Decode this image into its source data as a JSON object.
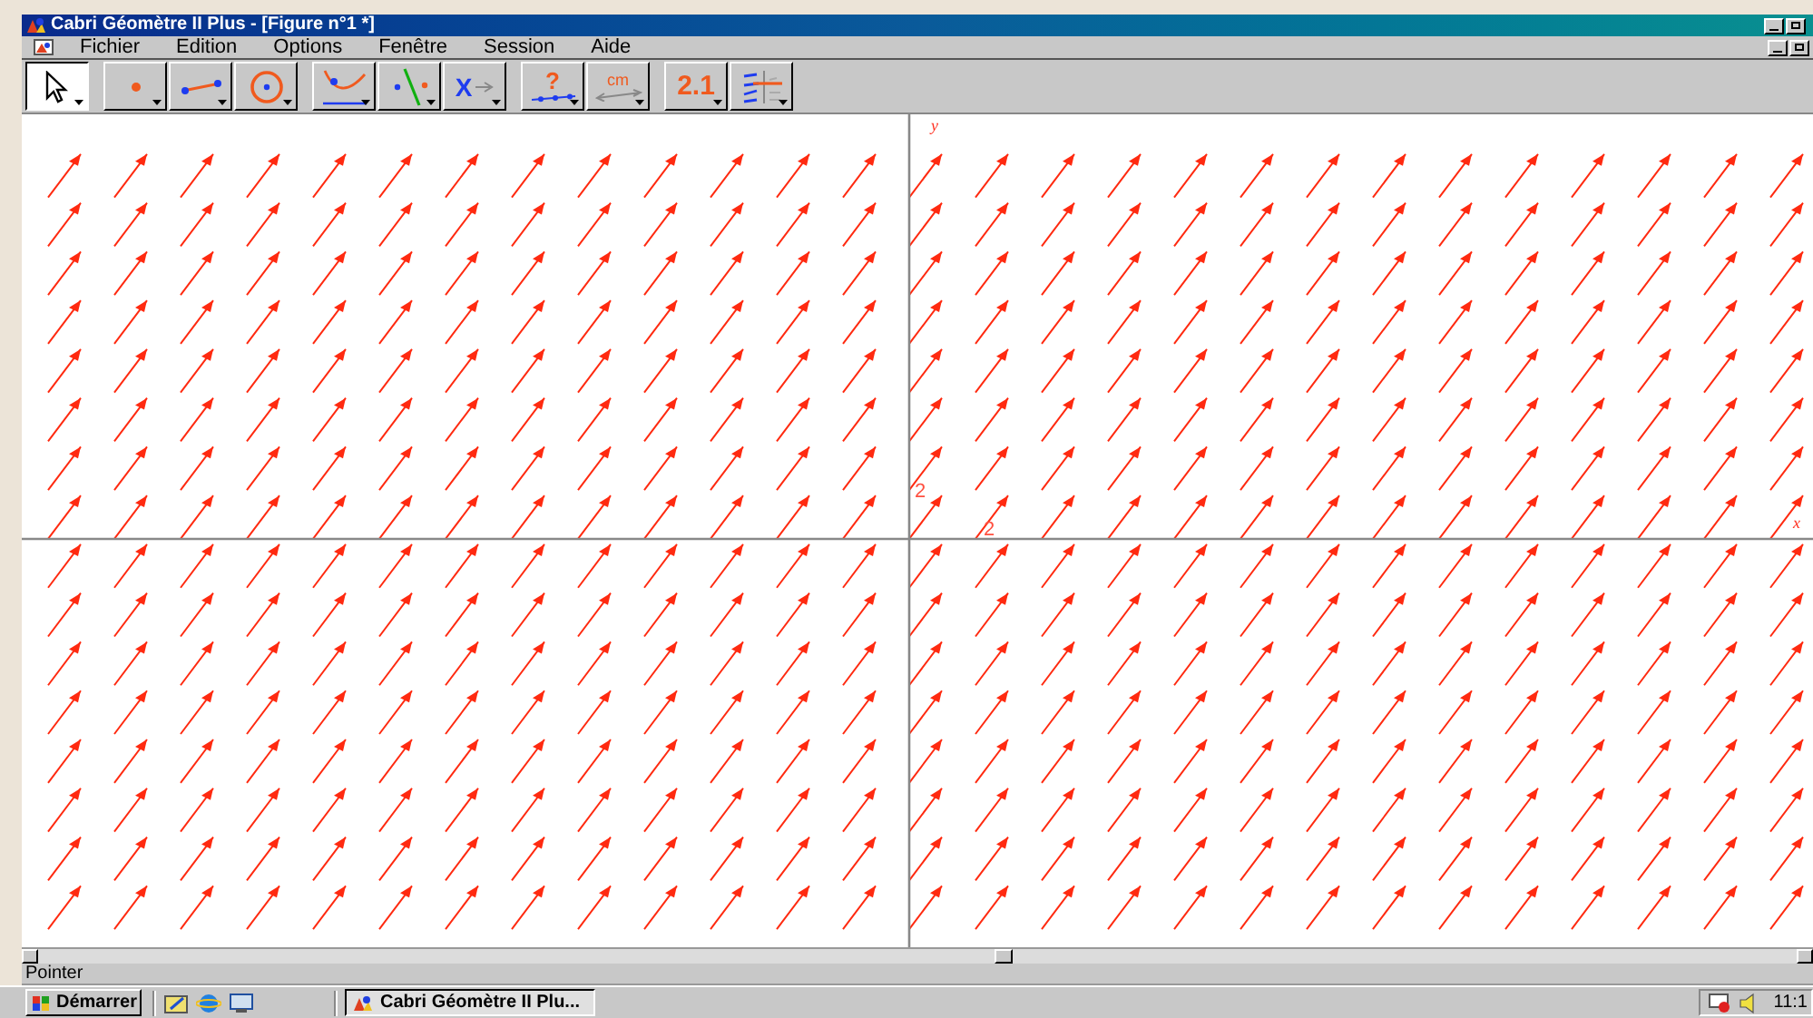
{
  "window": {
    "title": "Cabri Géomètre II Plus - [Figure n°1 *]"
  },
  "menu": [
    {
      "label": "Fichier"
    },
    {
      "label": "Edition"
    },
    {
      "label": "Options"
    },
    {
      "label": "Fenêtre"
    },
    {
      "label": "Session"
    },
    {
      "label": "Aide"
    }
  ],
  "toolbar": [
    {
      "kind": "pointer",
      "selected": true
    },
    {
      "kind": "point",
      "selected": false
    },
    {
      "kind": "line",
      "selected": false
    },
    {
      "kind": "circle",
      "selected": false
    },
    {
      "kind": "curve",
      "selected": false
    },
    {
      "kind": "perpendicular",
      "selected": false
    },
    {
      "kind": "transform",
      "glyph": "X",
      "selected": false
    },
    {
      "kind": "check",
      "glyph": "?",
      "selected": false
    },
    {
      "kind": "measure",
      "glyph": "cm",
      "selected": false
    },
    {
      "kind": "number",
      "glyph": "2.1",
      "selected": false
    },
    {
      "kind": "display",
      "selected": false
    }
  ],
  "canvas": {
    "x_axis_label": "x",
    "y_axis_label": "y",
    "x_tick": "2",
    "y_tick": "2"
  },
  "status_bar": "Pointer",
  "taskbar": {
    "start": "Démarrer",
    "task": "Cabri Géomètre II Plu...",
    "clock": "11:1"
  }
}
